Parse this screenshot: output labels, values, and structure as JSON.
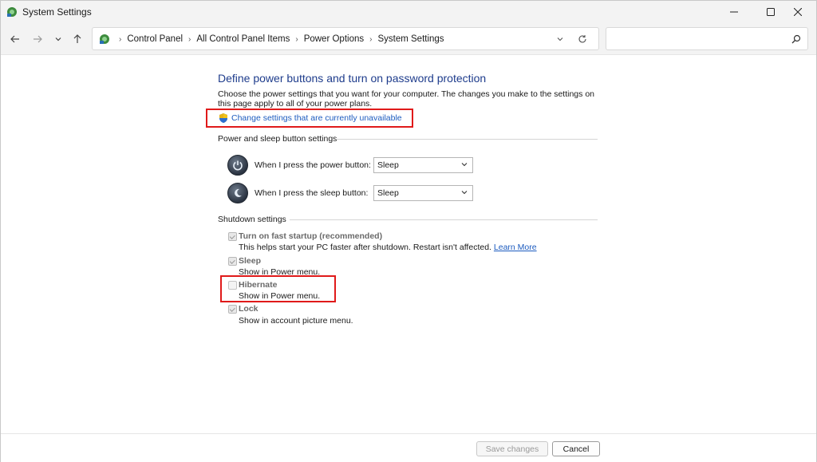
{
  "window": {
    "title": "System Settings"
  },
  "breadcrumbs": [
    "Control Panel",
    "All Control Panel Items",
    "Power Options",
    "System Settings"
  ],
  "search": {
    "placeholder": ""
  },
  "content": {
    "heading": "Define power buttons and turn on password protection",
    "description": "Choose the power settings that you want for your computer. The changes you make to the settings on this page apply to all of your power plans.",
    "change_link": "Change settings that are currently unavailable",
    "power_section": {
      "title": "Power and sleep button settings",
      "power_button_label": "When I press the power button:",
      "power_button_value": "Sleep",
      "sleep_button_label": "When I press the sleep button:",
      "sleep_button_value": "Sleep"
    },
    "shutdown_section": {
      "title": "Shutdown settings",
      "fast_startup_label": "Turn on fast startup (recommended)",
      "fast_startup_desc": "This helps start your PC faster after shutdown. Restart isn't affected.",
      "learn_more": "Learn More",
      "sleep_label": "Sleep",
      "sleep_desc": "Show in Power menu.",
      "hibernate_label": "Hibernate",
      "hibernate_desc": "Show in Power menu.",
      "lock_label": "Lock",
      "lock_desc": "Show in account picture menu."
    }
  },
  "footer": {
    "save_label": "Save changes",
    "cancel_label": "Cancel"
  },
  "colors": {
    "accent_heading": "#1e3c8c",
    "link": "#1c5bbf",
    "highlight_box": "#e01a1a"
  }
}
